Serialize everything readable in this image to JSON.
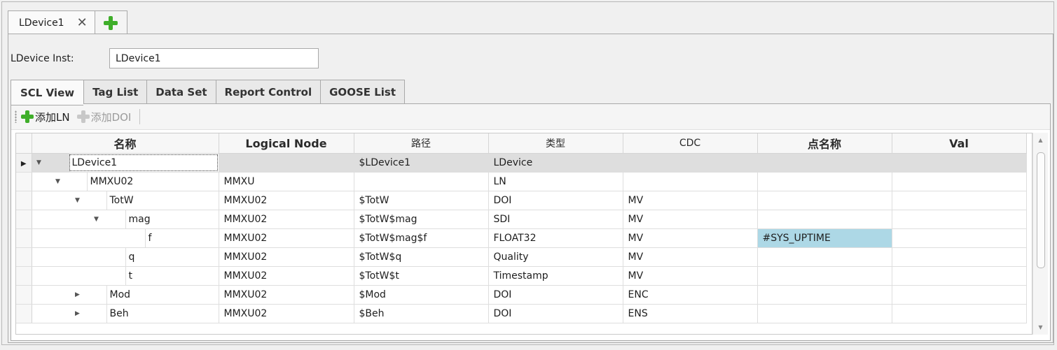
{
  "document_tabs": [
    {
      "label": "LDevice1",
      "close_icon": "close-icon"
    }
  ],
  "add_tab_icon": "plus-icon",
  "ldevice_inst": {
    "label": "LDevice Inst:",
    "value": "LDevice1"
  },
  "view_tabs": [
    {
      "label": "SCL View",
      "active": true
    },
    {
      "label": "Tag List"
    },
    {
      "label": "Data Set"
    },
    {
      "label": "Report Control"
    },
    {
      "label": "GOOSE List"
    }
  ],
  "toolbar": {
    "add_ln": "添加LN",
    "add_doi": "添加DOI"
  },
  "grid": {
    "columns": [
      "名称",
      "Logical Node",
      "路径",
      "类型",
      "CDC",
      "点名称",
      "Val"
    ],
    "rows": [
      {
        "name": "LDevice1",
        "ln": "",
        "path": "$LDevice1",
        "type": "LDevice",
        "cdc": "",
        "point": "",
        "val": ""
      },
      {
        "name": "MMXU02",
        "ln": "MMXU",
        "path": "",
        "type": "LN",
        "cdc": "",
        "point": "",
        "val": ""
      },
      {
        "name": "TotW",
        "ln": "MMXU02",
        "path": "$TotW",
        "type": "DOI",
        "cdc": "MV",
        "point": "",
        "val": ""
      },
      {
        "name": "mag",
        "ln": "MMXU02",
        "path": "$TotW$mag",
        "type": "SDI",
        "cdc": "MV",
        "point": "",
        "val": ""
      },
      {
        "name": "f",
        "ln": "MMXU02",
        "path": "$TotW$mag$f",
        "type": "FLOAT32",
        "cdc": "MV",
        "point": "#SYS_UPTIME",
        "val": ""
      },
      {
        "name": "q",
        "ln": "MMXU02",
        "path": "$TotW$q",
        "type": "Quality",
        "cdc": "MV",
        "point": "",
        "val": ""
      },
      {
        "name": "t",
        "ln": "MMXU02",
        "path": "$TotW$t",
        "type": "Timestamp",
        "cdc": "MV",
        "point": "",
        "val": ""
      },
      {
        "name": "Mod",
        "ln": "MMXU02",
        "path": "$Mod",
        "type": "DOI",
        "cdc": "ENC",
        "point": "",
        "val": ""
      },
      {
        "name": "Beh",
        "ln": "MMXU02",
        "path": "$Beh",
        "type": "DOI",
        "cdc": "ENS",
        "point": "",
        "val": ""
      }
    ]
  },
  "colors": {
    "highlight_cell": "#add8e6",
    "selected_row": "#dedede",
    "add_icon": "#3fae2a"
  }
}
